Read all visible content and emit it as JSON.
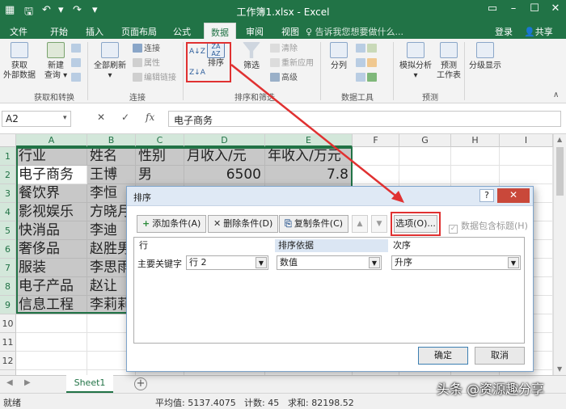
{
  "window": {
    "title": "工作簿1.xlsx - Excel",
    "login": "登录",
    "share": "共享",
    "tellme": "告诉我您想要做什么..."
  },
  "tabs": [
    "文件",
    "开始",
    "插入",
    "页面布局",
    "公式",
    "数据",
    "审阅",
    "视图"
  ],
  "active_tab": "数据",
  "ribbon": {
    "get_external": "获取\n外部数据",
    "new_query": "新建\n查询",
    "refresh_all": "全部刷新",
    "connections": "连接",
    "properties": "属性",
    "edit_links": "编辑链接",
    "sort": "排序",
    "filter": "筛选",
    "clear": "清除",
    "reapply": "重新应用",
    "advanced": "高级",
    "split": "分列",
    "whatif": "模拟分析",
    "forecast": "预测\n工作表",
    "outline": "分级显示",
    "groups": {
      "get_transform": "获取和转换",
      "connections": "连接",
      "sort_filter": "排序和筛选",
      "data_tools": "数据工具",
      "forecast": "预测"
    }
  },
  "formula_bar": {
    "name_box": "A2",
    "content": "电子商务",
    "fx": "fx"
  },
  "grid": {
    "columns": [
      "A",
      "B",
      "C",
      "D",
      "E",
      "F",
      "G",
      "H",
      "I"
    ],
    "rows": [
      "1",
      "2",
      "3",
      "4",
      "5",
      "6",
      "7",
      "8",
      "9",
      "10",
      "11",
      "12",
      "13"
    ],
    "data": [
      [
        "行业",
        "姓名",
        "性别",
        "月收入/元",
        "年收入/万元"
      ],
      [
        "电子商务",
        "王博",
        "男",
        "6500",
        "7.8"
      ],
      [
        "餐饮界",
        "李恒",
        "",
        "",
        ""
      ],
      [
        "影视娱乐",
        "方晓月",
        "",
        "",
        ""
      ],
      [
        "快消品",
        "李迪",
        "",
        "",
        ""
      ],
      [
        "奢侈品",
        "赵胜男",
        "",
        "",
        ""
      ],
      [
        "服装",
        "李思雨",
        "",
        "",
        ""
      ],
      [
        "电子产品",
        "赵让",
        "",
        "",
        ""
      ],
      [
        "信息工程",
        "李莉莉",
        "",
        "",
        ""
      ]
    ]
  },
  "sheets": [
    "Sheet1"
  ],
  "status": {
    "ready": "就绪",
    "average": "平均值: 5137.4075",
    "count": "计数: 45",
    "sum": "求和: 82198.52"
  },
  "dialog": {
    "title": "排序",
    "help": "?",
    "close": "✕",
    "add_level": "添加条件(A)",
    "delete_level": "删除条件(D)",
    "copy_level": "复制条件(C)",
    "options": "选项(O)...",
    "has_headers": "数据包含标题(H)",
    "col_headers": {
      "row": "行",
      "sort_on": "排序依据",
      "order": "次序"
    },
    "primary_key_label": "主要关键字",
    "primary_key_value": "行 2",
    "sort_on_value": "数值",
    "order_value": "升序",
    "ok": "确定",
    "cancel": "取消"
  },
  "watermark": "头条 @资源趣分享",
  "colors": {
    "excel_green": "#217346",
    "highlight_red": "#e03131",
    "selection_gray": "#c8c8c8"
  }
}
